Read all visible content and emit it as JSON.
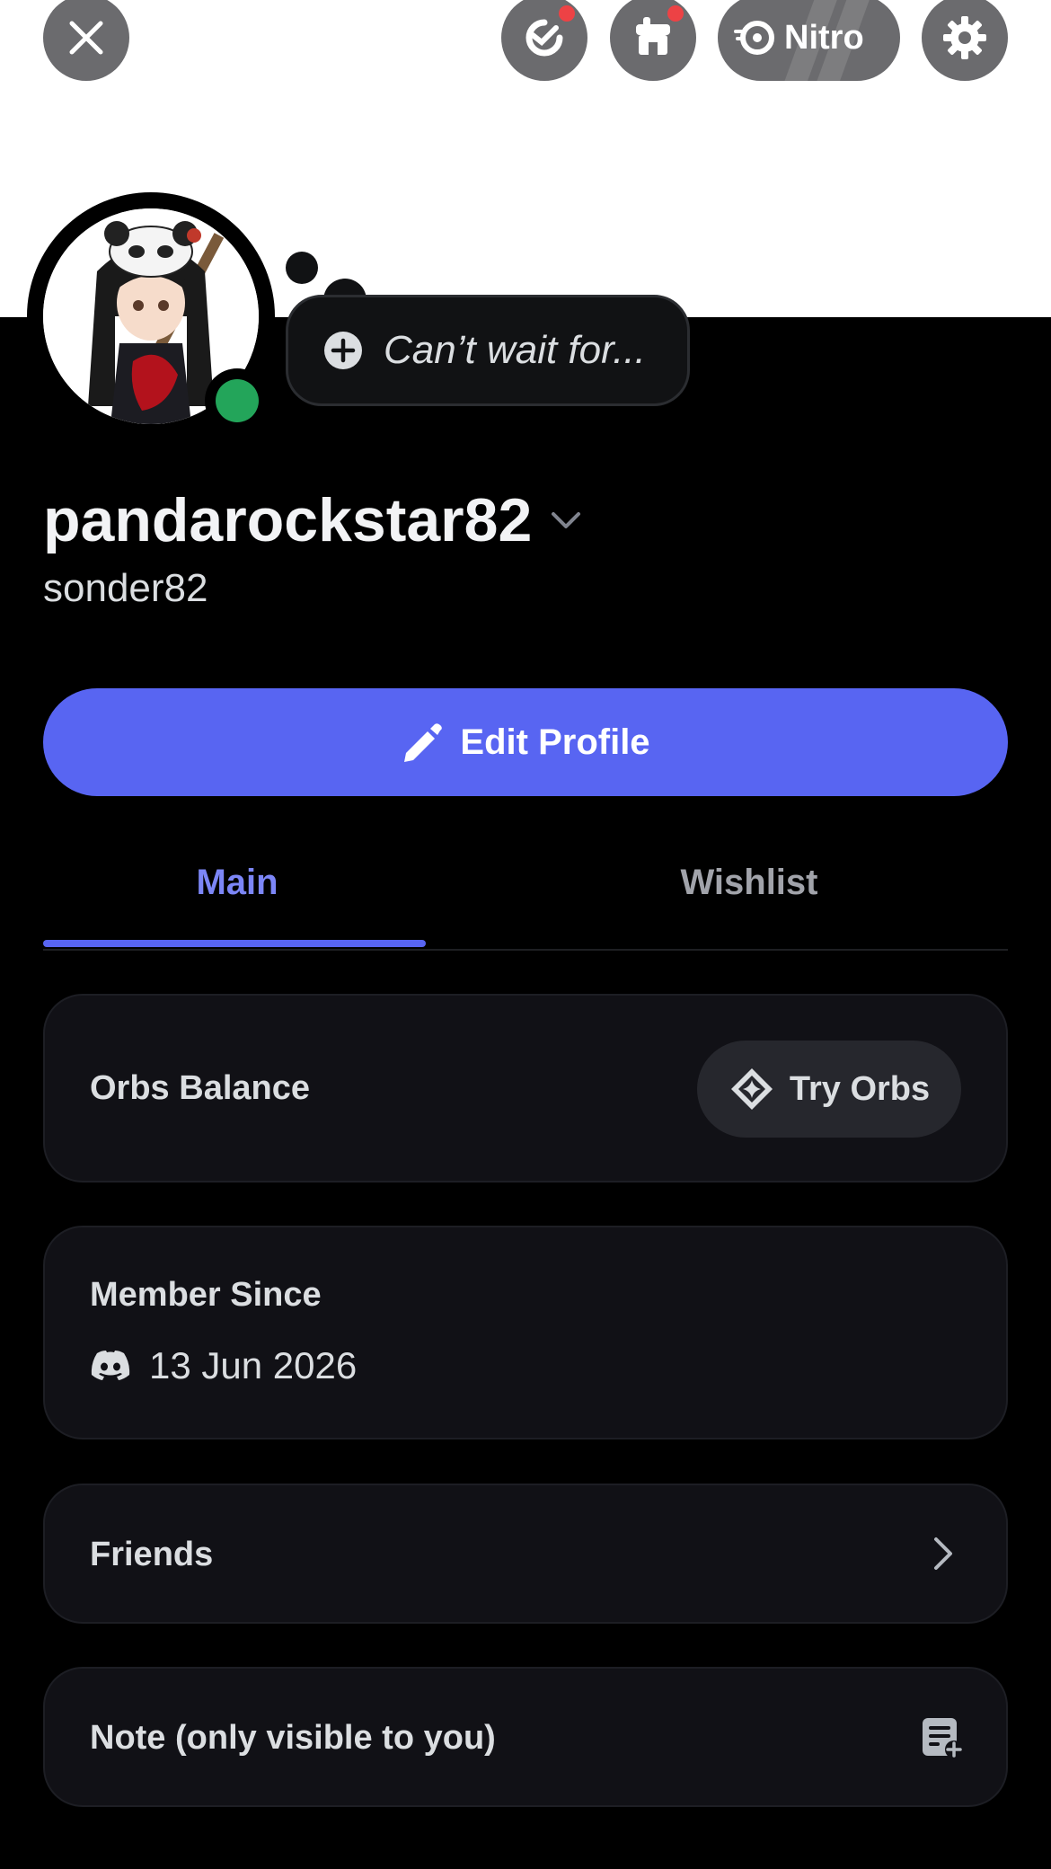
{
  "top_bar": {
    "close_icon": "close-icon",
    "quests_icon": "quests-icon",
    "shop_icon": "shop-icon",
    "nitro_label": "Nitro",
    "settings_icon": "gear-icon"
  },
  "status_bubble": {
    "placeholder": "Can’t wait for..."
  },
  "profile": {
    "display_name": "pandarockstar82",
    "username": "sonder82"
  },
  "edit_button": {
    "label": "Edit Profile"
  },
  "tabs": [
    {
      "label": "Main",
      "active": true
    },
    {
      "label": "Wishlist",
      "active": false
    }
  ],
  "orbs": {
    "title": "Orbs Balance",
    "button_label": "Try Orbs"
  },
  "member_since": {
    "title": "Member Since",
    "date": "13 Jun 2026"
  },
  "friends": {
    "title": "Friends"
  },
  "note": {
    "title": "Note (only visible to you)"
  },
  "colors": {
    "accent": "#5865f2",
    "online": "#23a55a",
    "notification": "#ed4245",
    "card_bg": "#111116"
  }
}
